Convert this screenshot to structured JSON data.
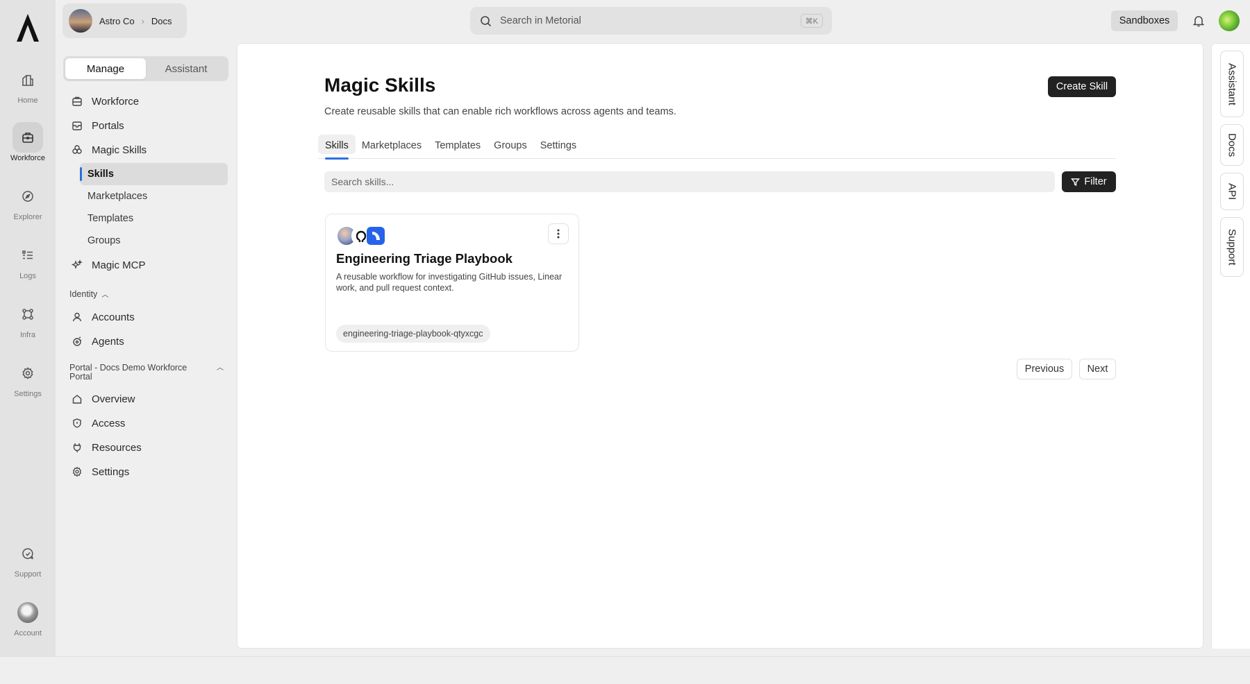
{
  "rail": {
    "items": [
      {
        "label": "Home",
        "icon": "home-icon"
      },
      {
        "label": "Workforce",
        "icon": "workforce-icon"
      },
      {
        "label": "Explorer",
        "icon": "compass-icon"
      },
      {
        "label": "Logs",
        "icon": "logs-icon"
      },
      {
        "label": "Infra",
        "icon": "infra-icon"
      },
      {
        "label": "Settings",
        "icon": "gear-icon"
      },
      {
        "label": "Support",
        "icon": "support-icon"
      },
      {
        "label": "Account",
        "icon": "avatar"
      }
    ]
  },
  "org": {
    "name": "Astro Co",
    "project": "Docs"
  },
  "sidebar": {
    "segments": [
      "Manage",
      "Assistant"
    ],
    "items": [
      {
        "label": "Workforce",
        "icon": "building-icon"
      },
      {
        "label": "Portals",
        "icon": "portal-icon"
      },
      {
        "label": "Magic Skills",
        "icon": "skills-icon"
      },
      {
        "label": "Magic MCP",
        "icon": "sparkle-icon"
      }
    ],
    "skills_sub": [
      "Skills",
      "Marketplaces",
      "Templates",
      "Groups"
    ],
    "identity": {
      "label": "Identity",
      "items": [
        {
          "label": "Accounts",
          "icon": "user-icon"
        },
        {
          "label": "Agents",
          "icon": "agent-icon"
        }
      ]
    },
    "portal": {
      "label": "Portal - Docs Demo Workforce Portal",
      "items": [
        {
          "label": "Overview",
          "icon": "home-icon"
        },
        {
          "label": "Access",
          "icon": "shield-icon"
        },
        {
          "label": "Resources",
          "icon": "plug-icon"
        },
        {
          "label": "Settings",
          "icon": "gear-icon"
        }
      ]
    }
  },
  "topbar": {
    "search_placeholder": "Search in Metorial",
    "shortcut": "⌘K",
    "sandboxes": "Sandboxes"
  },
  "main": {
    "title": "Magic Skills",
    "subtitle": "Create reusable skills that can enable rich workflows across agents and teams.",
    "create_label": "Create Skill",
    "tabs": [
      "Skills",
      "Marketplaces",
      "Templates",
      "Groups",
      "Settings"
    ],
    "search_placeholder": "Search skills...",
    "filter_label": "Filter",
    "card": {
      "title": "Engineering Triage Playbook",
      "description": "A reusable workflow for investigating GitHub issues, Linear work, and pull request context.",
      "slug": "engineering-triage-playbook-qtyxcgc"
    },
    "pagination": {
      "previous": "Previous",
      "next": "Next"
    }
  },
  "right_rail": [
    "Assistant",
    "Docs",
    "API",
    "Support"
  ],
  "colors": {
    "accent": "#2b6fe0",
    "dark_button": "#222222"
  }
}
